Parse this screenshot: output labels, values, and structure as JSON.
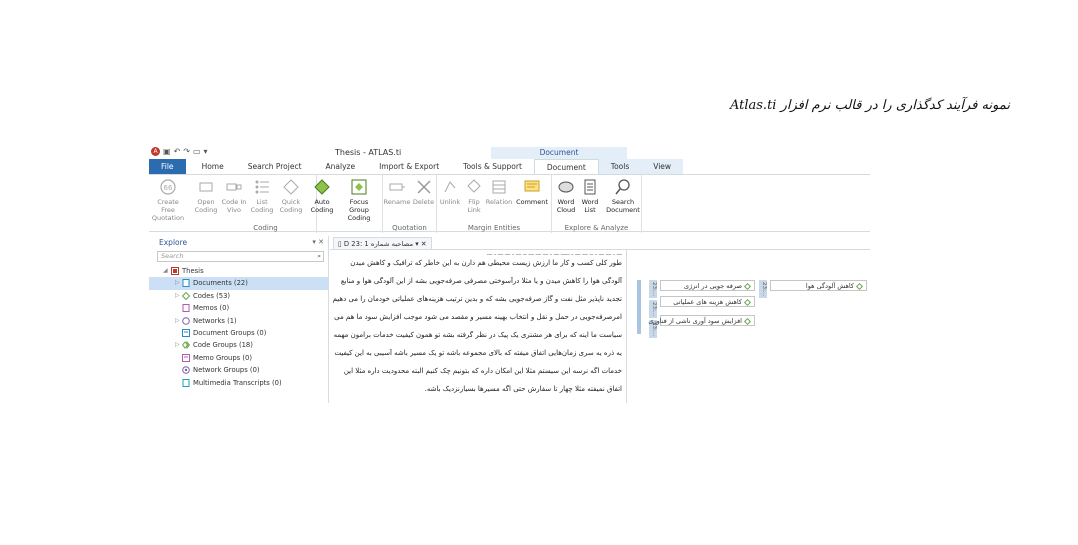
{
  "caption": "نمونه فرآیند کدگذاری را در قالب نرم افزار Atlas.ti",
  "window": {
    "title": "Thesis - ATLAS.ti",
    "context_tab_group": "Document"
  },
  "tabs": [
    {
      "label": "File"
    },
    {
      "label": "Home"
    },
    {
      "label": "Search Project"
    },
    {
      "label": "Analyze"
    },
    {
      "label": "Import & Export"
    },
    {
      "label": "Tools & Support"
    },
    {
      "label": "Document"
    },
    {
      "label": "Tools"
    },
    {
      "label": "View"
    }
  ],
  "ribbon": {
    "groups": {
      "coding": "Coding",
      "quotation": "Quotation",
      "margin_entities": "Margin Entities",
      "explore_analyze": "Explore & Analyze"
    },
    "buttons": {
      "create_free_quotation": "Create Free Quotation",
      "open_coding": "Open Coding",
      "code_in_vivo": "Code In Vivo",
      "list_coding": "List Coding",
      "quick_coding": "Quick Coding",
      "auto_coding": "Auto Coding",
      "focus_group_coding": "Focus Group Coding",
      "rename": "Rename",
      "delete": "Delete",
      "unlink": "Unlink",
      "flip_link": "Flip Link",
      "relation": "Relation",
      "comment": "Comment",
      "word_cloud": "Word Cloud",
      "word_list": "Word List",
      "search_document": "Search Document"
    }
  },
  "explore": {
    "title": "Explore",
    "search_placeholder": "Search",
    "root": "Thesis",
    "items": [
      {
        "label": "Documents (22)"
      },
      {
        "label": "Codes (53)"
      },
      {
        "label": "Memos (0)"
      },
      {
        "label": "Networks (1)"
      },
      {
        "label": "Document Groups (0)"
      },
      {
        "label": "Code Groups (18)"
      },
      {
        "label": "Memo Groups (0)"
      },
      {
        "label": "Network Groups (0)"
      },
      {
        "label": "Multimedia Transcripts (0)"
      }
    ]
  },
  "document_tab": {
    "label": "D 23: 1 مصاحبه شماره"
  },
  "document_lines": [
    "طور کلی کسب و کار ما ارزش زیست محیطی هم دارن به این خاطر که ترافیک و کاهش میدن",
    "آلودگی هوا را کاهش میدن و یا مثلا درآسوختی مصرفی صرفه‌جویی بشه از این آلودگی هوا و منابع",
    "تجدید ناپذیر مثل نفت و گاز صرفه‌جویی بشه که و بدین ترتیب هزینه‌های عملیاتی خودمان را می دهیم. این",
    "امرصرفه‌جویی در حمل و نقل و انتخاب بهینه مسیر و مقصد می شود موجب افزایش سود ما هم می ولی خب",
    "سیاست ما اینه که برای هر مشتری یک پیک در نظر گرفته بشه تو همون کیفیت خدمات برامون مهمه",
    "یه ذره یه سری زمان‌هایی اتفاق میفته که بالای مجموعه باشه تو یک مسیر باشه آسیبی به این کیفیت",
    "خدمات اگه نرسه این سیستم مثلا این امکان داره که بتونیم چک کنیم البته محدودیت داره مثلا این",
    "اتفاق نمیفته مثلا چهار تا سفارش حتی اگه مسیرها بسیارنزدیک باشه."
  ],
  "margin": {
    "col_labels": [
      "23:...",
      "23:...",
      "23:...",
      "23:..."
    ],
    "codes": [
      {
        "label": "صرفه جویی در انرژی"
      },
      {
        "label": "کاهش هزینه های عملیاتی"
      },
      {
        "label": "افزایش سود آوری ناشی از فناوری"
      },
      {
        "label": "کاهش آلودگی هوا"
      }
    ]
  }
}
